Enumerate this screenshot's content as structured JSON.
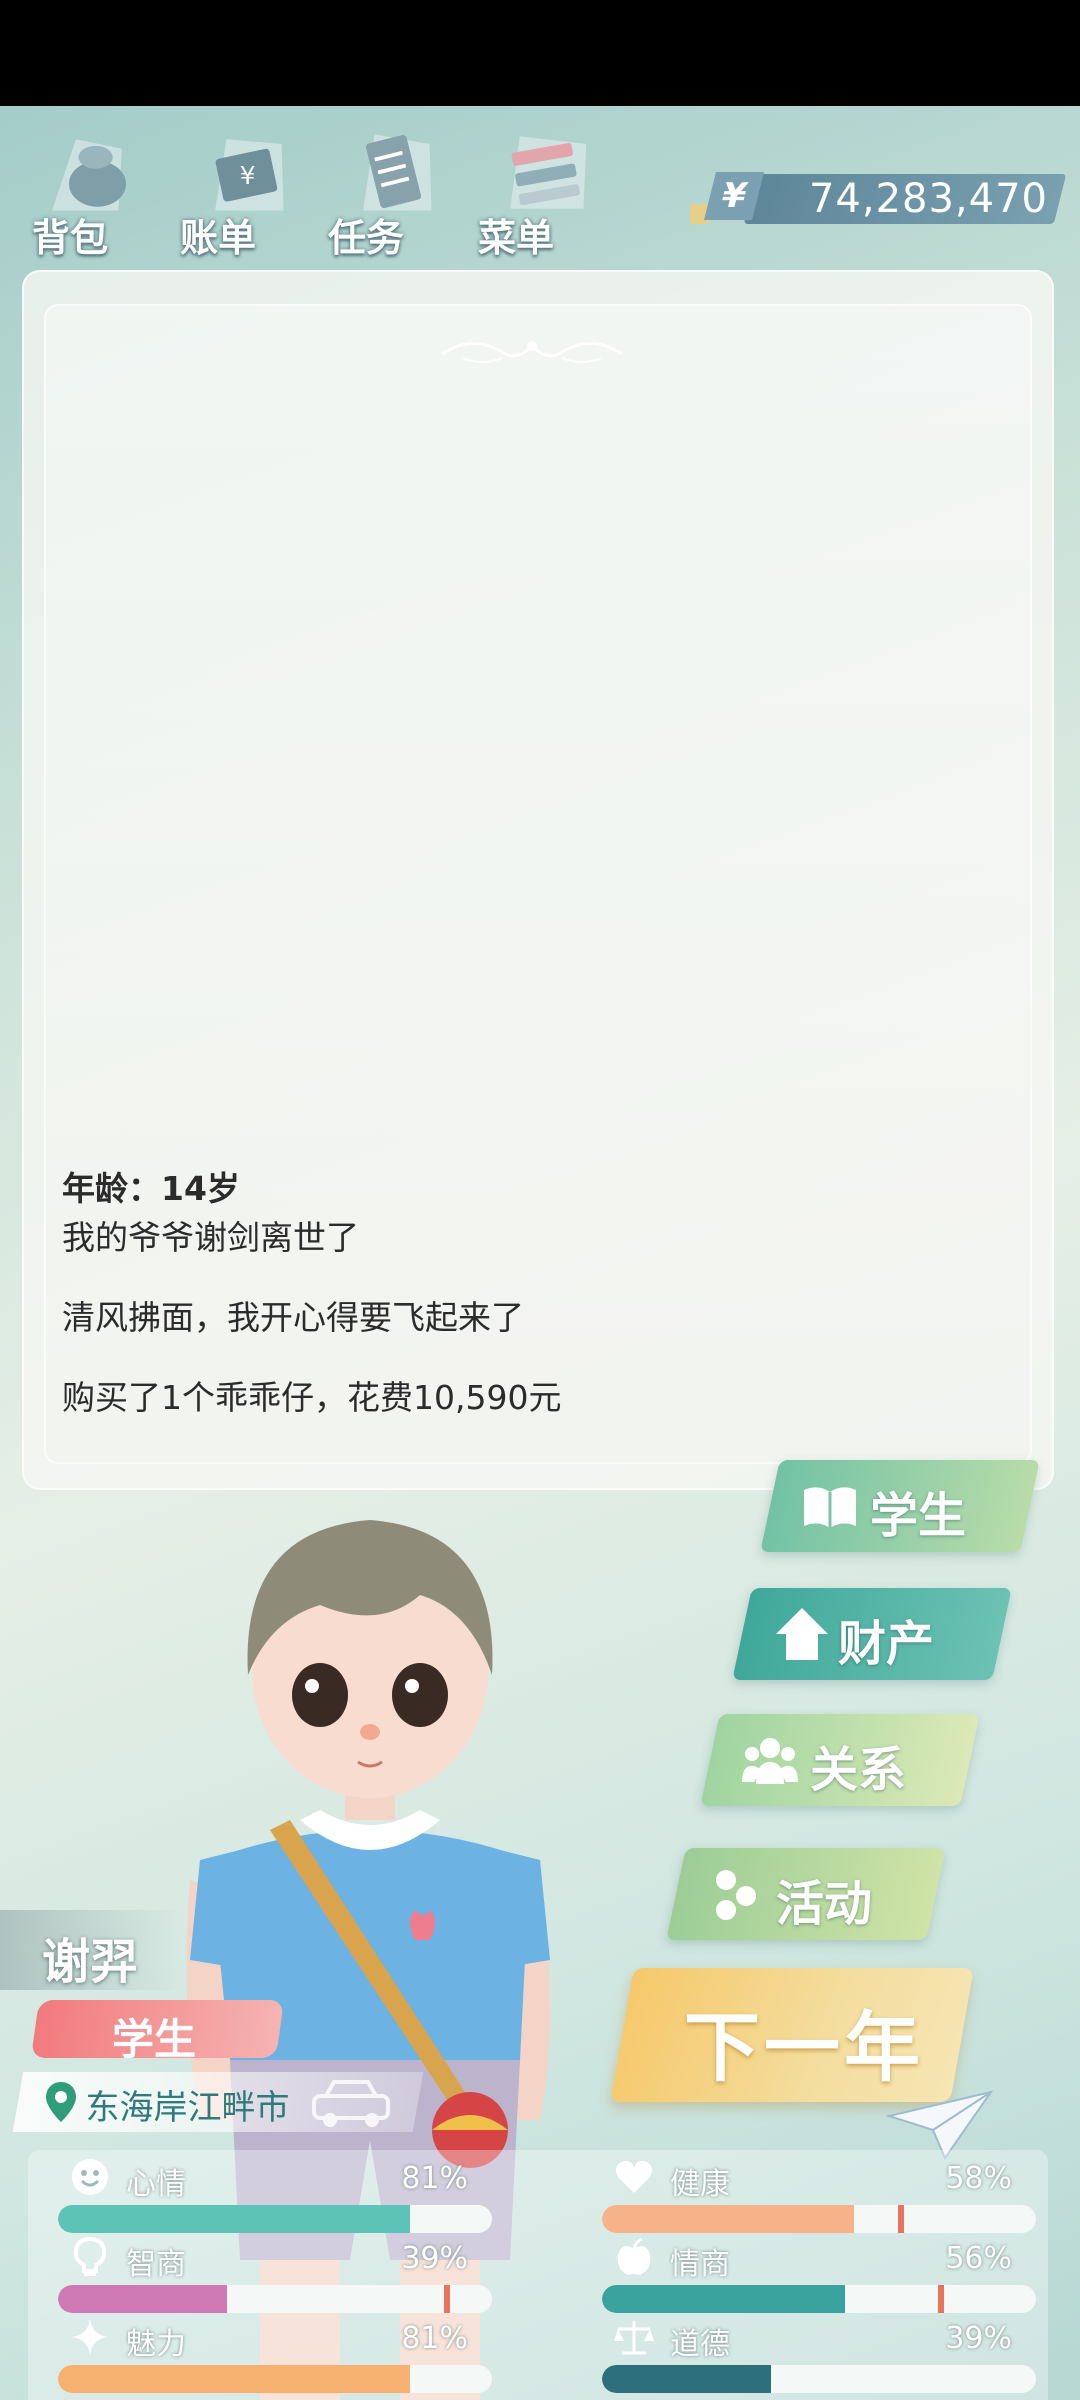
{
  "menu": {
    "items": [
      {
        "label": "背包",
        "icon": "backpack-icon"
      },
      {
        "label": "账单",
        "icon": "bill-icon"
      },
      {
        "label": "任务",
        "icon": "task-list-icon"
      },
      {
        "label": "菜单",
        "icon": "menu-icon"
      }
    ]
  },
  "money": {
    "currency_symbol": "¥",
    "value": "74,283,470"
  },
  "log": {
    "age": "年龄：14岁",
    "entries": [
      "我的爷爷谢剑离世了",
      "清风拂面，我开心得要飞起来了",
      "购买了1个乖乖仔，花费10,590元"
    ]
  },
  "nav": {
    "student": "学生",
    "property": "财产",
    "relations": "关系",
    "activities": "活动",
    "next_year": "下一年"
  },
  "character": {
    "name": "谢羿",
    "role": "学生",
    "location": "东海岸江畔市"
  },
  "stats": [
    {
      "label": "心情",
      "value": "81%",
      "level": 0.81,
      "icon": "smiley-icon",
      "color": "#5cc3b6"
    },
    {
      "label": "健康",
      "value": "58%",
      "level": 0.58,
      "icon": "heart-icon",
      "color": "#f6b38a"
    },
    {
      "label": "智商",
      "value": "39%",
      "level": 0.39,
      "icon": "lightbulb-icon",
      "color": "#d07ab5"
    },
    {
      "label": "情商",
      "value": "56%",
      "level": 0.56,
      "icon": "apple-icon",
      "color": "#3aa39d"
    },
    {
      "label": "魅力",
      "value": "81%",
      "level": 0.81,
      "icon": "sparkle-icon",
      "color": "#f6b070"
    },
    {
      "label": "道德",
      "value": "39%",
      "level": 0.39,
      "icon": "scales-icon",
      "color": "#2d6f7a"
    }
  ]
}
